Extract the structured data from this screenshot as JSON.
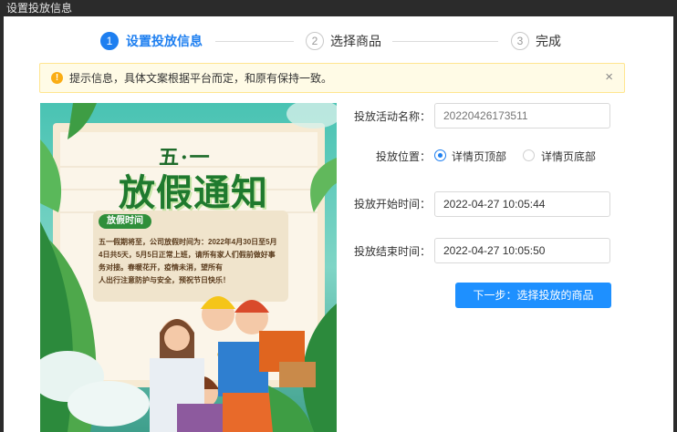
{
  "window": {
    "title": "设置投放信息"
  },
  "steps": [
    {
      "number": "1",
      "label": "设置投放信息"
    },
    {
      "number": "2",
      "label": "选择商品"
    },
    {
      "number": "3",
      "label": "完成"
    }
  ],
  "alert": {
    "icon": "info-exclamation-icon",
    "text": "提示信息，具体文案根据平台而定，和原有保持一致。",
    "close_icon": "close-icon"
  },
  "poster": {
    "headline_small": "五·一",
    "headline": "放假通知",
    "section_tag": "放假时间",
    "body_lines": [
      "五一假期将至，公司放假时间为：2022年4月30日至5月",
      "4日共5天，5月5日正常上班，请所有家人们假前做好事",
      "务对接。春暖花开，疫情未消，望所有",
      "人出行注意防护与安全，预祝节日快乐！"
    ]
  },
  "form": {
    "name_label": "投放活动名称：",
    "name_placeholder": "20220426173511",
    "position_label": "投放位置：",
    "position_options": [
      {
        "label": "详情页顶部",
        "selected": true
      },
      {
        "label": "详情页底部",
        "selected": false
      }
    ],
    "start_label": "投放开始时间：",
    "start_value": "2022-04-27 10:05:44",
    "end_label": "投放结束时间：",
    "end_value": "2022-04-27 10:05:50",
    "next_button": "下一步：选择投放的商品"
  },
  "colors": {
    "primary": "#1e7ff0",
    "button": "#1e90ff",
    "alert_bg": "#fffbe6",
    "alert_border": "#ffe58f",
    "warning": "#faad14"
  }
}
